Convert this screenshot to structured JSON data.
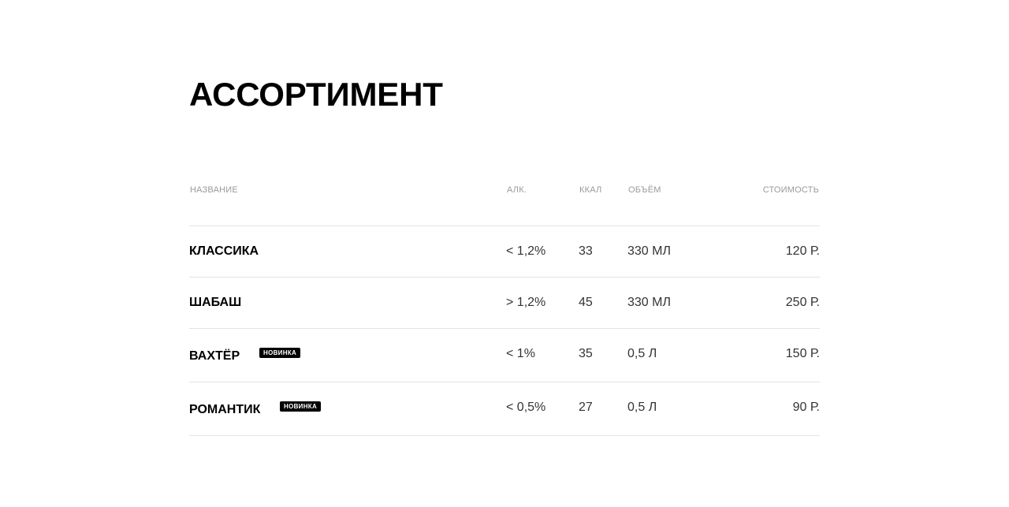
{
  "page": {
    "title": "АССОРТИМЕНТ"
  },
  "table": {
    "headers": {
      "name": "НАЗВАНИЕ",
      "alc": "АЛК.",
      "kcal": "ККАЛ",
      "volume": "ОБЪЁМ",
      "price": "СТОИМОСТЬ"
    },
    "rows": [
      {
        "name": "КЛАССИКА",
        "badge": "",
        "alc": "< 1,2%",
        "kcal": "33",
        "volume": "330 МЛ",
        "price": "120 Р."
      },
      {
        "name": "ШАБАШ",
        "badge": "",
        "alc": "> 1,2%",
        "kcal": "45",
        "volume": "330 МЛ",
        "price": "250 Р."
      },
      {
        "name": "ВАХТЁР",
        "badge": "НОВИНКА",
        "alc": "< 1%",
        "kcal": "35",
        "volume": "0,5 Л",
        "price": "150 Р."
      },
      {
        "name": "РОМАНТИК",
        "badge": "НОВИНКА",
        "alc": "< 0,5%",
        "kcal": "27",
        "volume": "0,5 Л",
        "price": "90 Р."
      }
    ]
  },
  "colors": {
    "text": "#000000",
    "muted": "#9a9a9a",
    "cell_text": "#333333",
    "divider": "#e3e3e3",
    "badge_bg": "#000000",
    "badge_text": "#ffffff"
  }
}
